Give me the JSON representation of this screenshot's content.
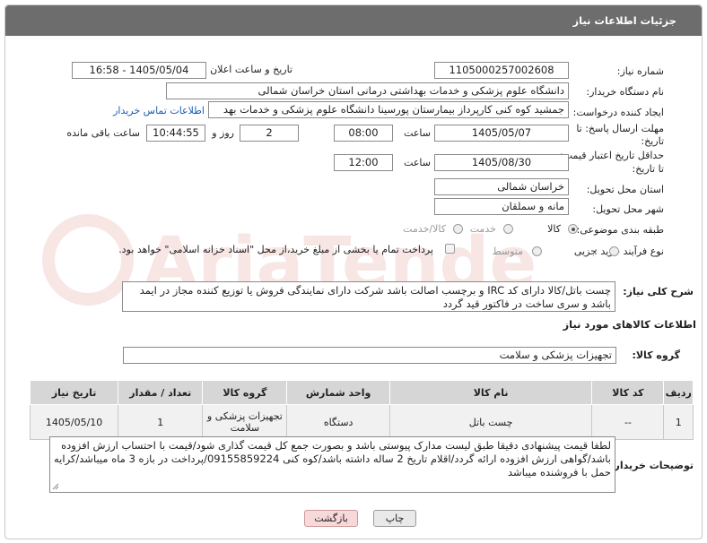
{
  "header": {
    "title": "جزئیات اطلاعات نیاز"
  },
  "need_number": {
    "label": "شماره نیاز:",
    "value": "1105000257002608"
  },
  "announce": {
    "label": "تاریخ و ساعت اعلان عمومی:",
    "value": "1405/05/04 - 16:58"
  },
  "buyer": {
    "label": "نام دستگاه خریدار:",
    "value": "دانشگاه علوم پزشکی و خدمات بهداشتی درمانی استان خراسان شمالی"
  },
  "creator": {
    "label": "ایجاد کننده درخواست:",
    "value": "جمشید کوه کنی کارپرداز بیمارستان پورسینا دانشگاه علوم پزشکی و خدمات بهد",
    "contact_link": "اطلاعات تماس خریدار"
  },
  "deadline": {
    "label_line1": "مهلت ارسال پاسخ: تا",
    "label_line2": "تاریخ:",
    "date": "1405/05/07",
    "time_label": "ساعت",
    "time": "08:00",
    "days": "2",
    "days_label": "روز و",
    "remaining": "10:44:55",
    "remaining_label": "ساعت باقی مانده"
  },
  "validity": {
    "label_line1": "حداقل تاریخ اعتبار قیمت:",
    "label_line2": "تا تاریخ:",
    "date": "1405/08/30",
    "time_label": "ساعت",
    "time": "12:00"
  },
  "province": {
    "label": "استان محل تحویل:",
    "value": "خراسان شمالی"
  },
  "city": {
    "label": "شهر محل تحویل:",
    "value": "مانه و سملقان"
  },
  "category": {
    "label": "طبقه بندی موضوعی:",
    "options": [
      "کالا",
      "خدمت",
      "کالا/خدمت"
    ]
  },
  "process": {
    "label": "نوع فرآیند خرید :",
    "options": [
      "جزیی",
      "متوسط"
    ],
    "payment_text": "پرداخت تمام یا بخشی از مبلغ خرید،از محل \"اسناد خزانه اسلامی\" خواهد بود."
  },
  "summary": {
    "label": "شرح کلی نیاز:",
    "text": "چست باتل/کالا دارای کد IRC و برچسب اصالت باشد شرکت دارای نمایندگی فروش یا توزیع کننده  مجاز در ایمد باشد و سری ساخت در فاکتور قید گردد"
  },
  "goods_info": {
    "title": "اطلاعات کالاهای مورد نیاز"
  },
  "goods_group": {
    "label": "گروه کالا:",
    "value": "تجهیزات پزشکی و سلامت"
  },
  "table": {
    "headers": [
      "ردیف",
      "کد کالا",
      "نام کالا",
      "واحد شمارش",
      "گروه کالا",
      "تعداد / مقدار",
      "تاریخ نیاز"
    ],
    "row": {
      "index": "1",
      "code": "--",
      "name": "چست باتل",
      "unit": "دستگاه",
      "group": "تجهیزات پزشکی و سلامت",
      "qty": "1",
      "date": "1405/05/10"
    }
  },
  "buyer_notes": {
    "label": "توضیحات خریدار:",
    "text": "لطفا قیمت پیشنهادی دقیقا طبق لیست مدارک پیوستی باشد و بصورت جمع کل قیمت گذاری شود/قیمت با احتساب ارزش افزوده باشد/گواهی ارزش افزوده ارائه گردد/اقلام تاریخ 2 ساله داشته باشد/کوه کنی 09155859224/پرداخت در بازه 3  ماه میباشد/کرایه حمل با فروشنده میباشد"
  },
  "buttons": {
    "print": "چاپ",
    "back": "بازگشت"
  },
  "watermark": {
    "text": "AriaTender.neT"
  },
  "colors": {
    "header": "#6d6d6d",
    "link": "#1a5fb4",
    "table_header": "#d6d6d6"
  }
}
